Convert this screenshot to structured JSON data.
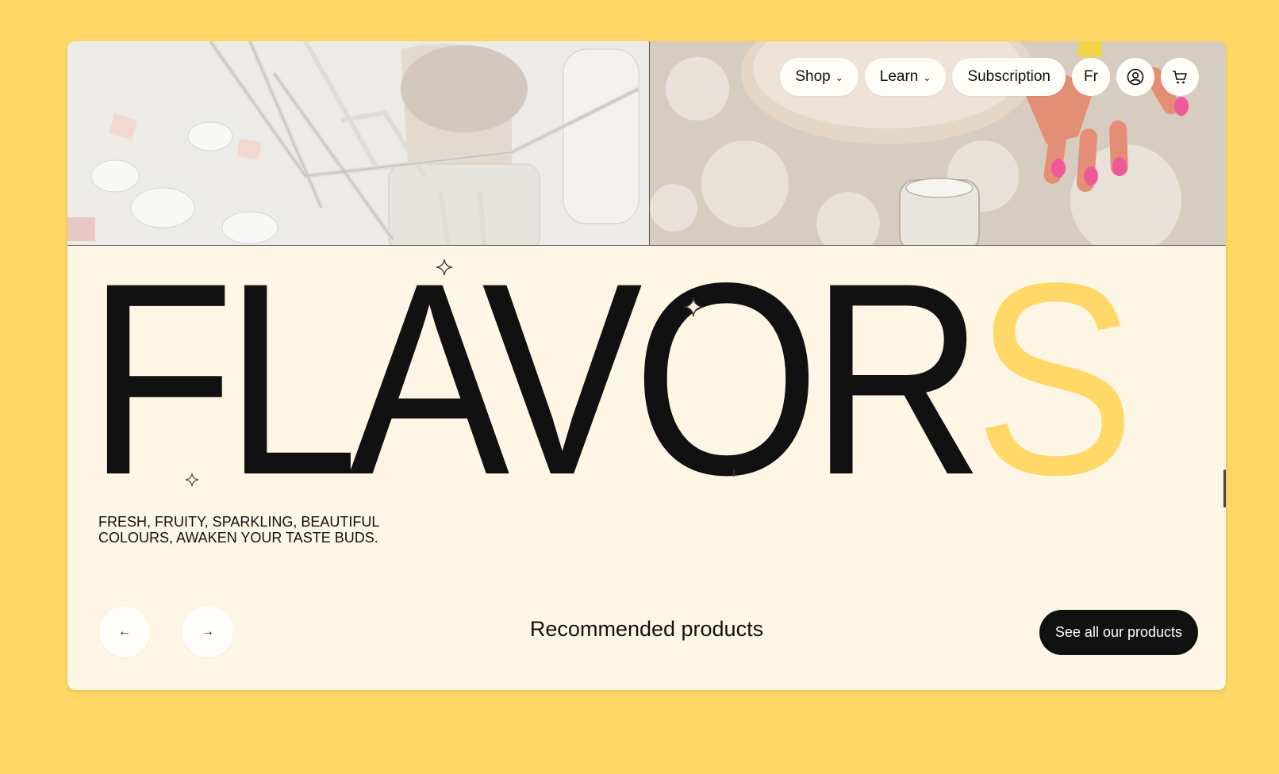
{
  "nav": {
    "shop": "Shop",
    "learn": "Learn",
    "subscription": "Subscription",
    "language": "Fr",
    "account_icon": "user-circle-icon",
    "cart_icon": "cart-icon"
  },
  "hero": {
    "headline_main": "FLAVOR",
    "headline_accent": "S",
    "tagline_line1": "FRESH, FRUITY, SPARKLING, BEAUTIFUL",
    "tagline_line2": "COLOURS, AWAKEN YOUR TASTE BUDS."
  },
  "products": {
    "title": "Recommended products",
    "see_all": "See all our products",
    "prev_icon": "←",
    "next_icon": "→"
  },
  "colors": {
    "background": "#ffd867",
    "card": "#fdf6e4",
    "accent": "#ffd867",
    "text": "#111111"
  }
}
